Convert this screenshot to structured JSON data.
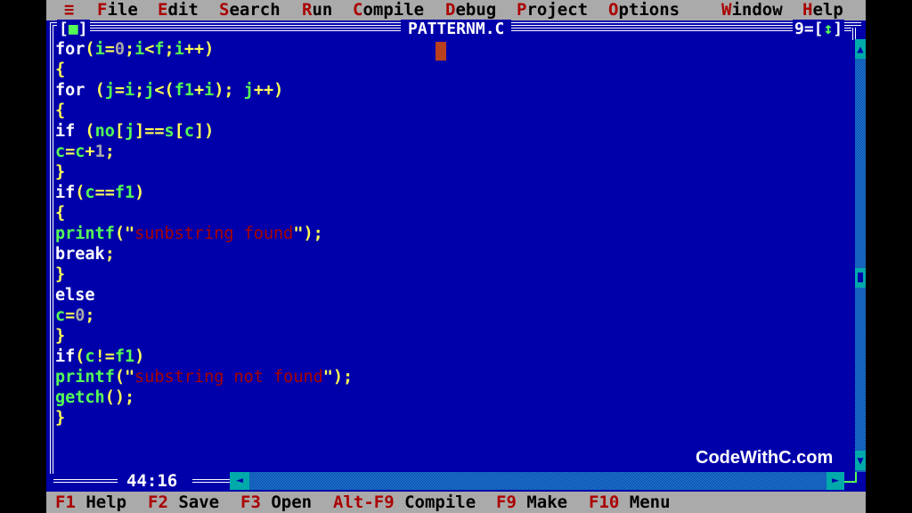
{
  "menubar": {
    "system_icon": "≡",
    "items": [
      {
        "hot": "F",
        "rest": "ile"
      },
      {
        "hot": "E",
        "rest": "dit"
      },
      {
        "hot": "S",
        "rest": "earch"
      },
      {
        "hot": "R",
        "rest": "un"
      },
      {
        "hot": "C",
        "rest": "ompile"
      },
      {
        "hot": "D",
        "rest": "ebug"
      },
      {
        "hot": "P",
        "rest": "roject"
      },
      {
        "hot": "O",
        "rest": "ptions"
      },
      {
        "hot": "W",
        "rest": "indow"
      },
      {
        "hot": "H",
        "rest": "elp"
      }
    ]
  },
  "window": {
    "close_left": "[",
    "close_icon": "■",
    "close_right": "]",
    "title": "PATTERNM.C",
    "number": "9",
    "zoom_left": "=[",
    "zoom_icon": "↕",
    "zoom_right": "]",
    "cursor_position": "44:16",
    "scroll_up_icon": "▲",
    "scroll_down_icon": "▼",
    "scroll_left_icon": "◄",
    "scroll_right_icon": "►"
  },
  "code": [
    [
      [
        "kw",
        "for"
      ],
      [
        "op",
        "("
      ],
      [
        "id",
        "i"
      ],
      [
        "op",
        "="
      ],
      [
        "num",
        "0"
      ],
      [
        "op",
        ";"
      ],
      [
        "id",
        "i"
      ],
      [
        "op",
        "<"
      ],
      [
        "id",
        "f"
      ],
      [
        "op",
        ";"
      ],
      [
        "id",
        "i"
      ],
      [
        "op",
        "++)"
      ]
    ],
    [
      [
        "op",
        "{"
      ]
    ],
    [
      [
        "kw",
        "for "
      ],
      [
        "op",
        "("
      ],
      [
        "id",
        "j"
      ],
      [
        "op",
        "="
      ],
      [
        "id",
        "i"
      ],
      [
        "op",
        ";"
      ],
      [
        "id",
        "j"
      ],
      [
        "op",
        "<("
      ],
      [
        "id",
        "f1"
      ],
      [
        "op",
        "+"
      ],
      [
        "id",
        "i"
      ],
      [
        "op",
        "); "
      ],
      [
        "id",
        "j"
      ],
      [
        "op",
        "++)"
      ]
    ],
    [
      [
        "op",
        "{"
      ]
    ],
    [
      [
        "kw",
        "if "
      ],
      [
        "op",
        "("
      ],
      [
        "id",
        "no"
      ],
      [
        "op",
        "["
      ],
      [
        "id",
        "j"
      ],
      [
        "op",
        "]=="
      ],
      [
        "id",
        "s"
      ],
      [
        "op",
        "["
      ],
      [
        "id",
        "c"
      ],
      [
        "op",
        "])"
      ]
    ],
    [
      [
        "id",
        "c"
      ],
      [
        "op",
        "="
      ],
      [
        "id",
        "c"
      ],
      [
        "op",
        "+"
      ],
      [
        "num",
        "1"
      ],
      [
        "op",
        ";"
      ]
    ],
    [
      [
        "op",
        "}"
      ]
    ],
    [
      [
        "kw",
        "if"
      ],
      [
        "op",
        "("
      ],
      [
        "id",
        "c"
      ],
      [
        "op",
        "=="
      ],
      [
        "id",
        "f1"
      ],
      [
        "op",
        ")"
      ]
    ],
    [
      [
        "op",
        "{"
      ]
    ],
    [
      [
        "id",
        "printf"
      ],
      [
        "op",
        "(\""
      ],
      [
        "str",
        "sunbstring found"
      ],
      [
        "op",
        "\");"
      ]
    ],
    [
      [
        "kw",
        "break"
      ],
      [
        "op",
        ";"
      ]
    ],
    [
      [
        "op",
        "}"
      ]
    ],
    [
      [
        "kw",
        "else"
      ]
    ],
    [
      [
        "id",
        "c"
      ],
      [
        "op",
        "="
      ],
      [
        "num",
        "0"
      ],
      [
        "op",
        ";"
      ]
    ],
    [
      [
        "op",
        "}"
      ]
    ],
    [
      [
        "kw",
        "if"
      ],
      [
        "op",
        "("
      ],
      [
        "id",
        "c"
      ],
      [
        "op",
        "!="
      ],
      [
        "id",
        "f1"
      ],
      [
        "op",
        ")"
      ]
    ],
    [
      [
        "id",
        "printf"
      ],
      [
        "op",
        "(\""
      ],
      [
        "str",
        "substring not found"
      ],
      [
        "op",
        "\");"
      ]
    ],
    [
      [
        "id",
        "getch"
      ],
      [
        "op",
        "();"
      ]
    ],
    [
      [
        "op",
        "}"
      ]
    ]
  ],
  "watermark": "CodeWithC.com",
  "statusbar": [
    {
      "key": "F1",
      "label": "Help"
    },
    {
      "key": "F2",
      "label": "Save"
    },
    {
      "key": "F3",
      "label": "Open"
    },
    {
      "key": "Alt-F9",
      "label": "Compile"
    },
    {
      "key": "F9",
      "label": "Make"
    },
    {
      "key": "F10",
      "label": "Menu"
    }
  ],
  "colors": {
    "background": "#0000aa",
    "menubar": "#aaaaaa",
    "hotkey": "#aa0000",
    "keyword": "#ffffff",
    "identifier": "#55ff55",
    "operator": "#ffff55",
    "string": "#aa0000",
    "scrollbar": "#00aaaa",
    "cursor": "#b8401e"
  }
}
